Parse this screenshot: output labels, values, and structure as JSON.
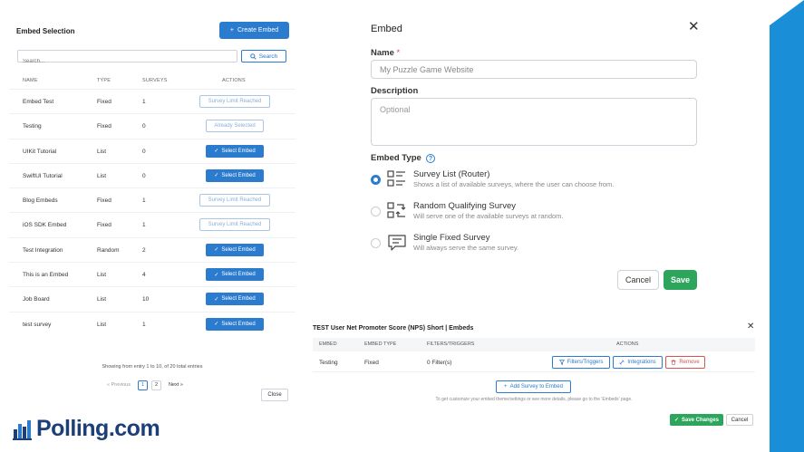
{
  "left_panel": {
    "title": "Embed Selection",
    "create_label": "Create Embed",
    "search_placeholder": "Search...",
    "search_label": "Search",
    "columns": [
      "NAME",
      "TYPE",
      "SURVEYS",
      "ACTIONS"
    ],
    "rows": [
      {
        "name": "Embed Test",
        "type": "Fixed",
        "surveys": "1",
        "action": "Survey Limit Reached",
        "action_kind": "disabled"
      },
      {
        "name": "Testing",
        "type": "Fixed",
        "surveys": "0",
        "action": "Already Selected",
        "action_kind": "disabled"
      },
      {
        "name": "UIKit Tutorial",
        "type": "List",
        "surveys": "0",
        "action": "Select Embed",
        "action_kind": "select"
      },
      {
        "name": "SwiftUI Tutorial",
        "type": "List",
        "surveys": "0",
        "action": "Select Embed",
        "action_kind": "select"
      },
      {
        "name": "Blog Embeds",
        "type": "Fixed",
        "surveys": "1",
        "action": "Survey Limit Reached",
        "action_kind": "disabled"
      },
      {
        "name": "iOS SDK Embed",
        "type": "Fixed",
        "surveys": "1",
        "action": "Survey Limit Reached",
        "action_kind": "disabled"
      },
      {
        "name": "Test Integration",
        "type": "Random",
        "surveys": "2",
        "action": "Select Embed",
        "action_kind": "select"
      },
      {
        "name": "This is an Embed",
        "type": "List",
        "surveys": "4",
        "action": "Select Embed",
        "action_kind": "select"
      },
      {
        "name": "Job Board",
        "type": "List",
        "surveys": "10",
        "action": "Select Embed",
        "action_kind": "select"
      },
      {
        "name": "test survey",
        "type": "List",
        "surveys": "1",
        "action": "Select Embed",
        "action_kind": "select"
      }
    ],
    "entries_text": "Showing from entry 1 to 10, of 20 total entries",
    "pager": {
      "prev": "« Previous",
      "pages": [
        "1",
        "2"
      ],
      "next": "Next »"
    },
    "close_label": "Close"
  },
  "logo": {
    "text": "Polling.com"
  },
  "embed_modal": {
    "title": "Embed",
    "name_label": "Name",
    "required_mark": "*",
    "name_placeholder": "My Puzzle Game Website",
    "description_label": "Description",
    "description_placeholder": "Optional",
    "embed_type_label": "Embed Type",
    "options": [
      {
        "title": "Survey List (Router)",
        "desc": "Shows a list of available surveys, where the user can choose from.",
        "checked": true,
        "icon": "list-icon"
      },
      {
        "title": "Random Qualifying Survey",
        "desc": "Will serve one of the available surveys at random.",
        "checked": false,
        "icon": "shuffle-icon"
      },
      {
        "title": "Single Fixed Survey",
        "desc": "Will always serve the same survey.",
        "checked": false,
        "icon": "message-icon"
      }
    ],
    "cancel_label": "Cancel",
    "save_label": "Save"
  },
  "nps_panel": {
    "title": "TEST User Net Promoter Score (NPS) Short | Embeds",
    "columns": [
      "EMBED",
      "EMBED TYPE",
      "FILTERS/TRIGGERS",
      "ACTIONS"
    ],
    "row": {
      "embed": "Testing",
      "type": "Fixed",
      "filters": "0 Filter(s)"
    },
    "filters_label": "Filters/Triggers",
    "integrations_label": "Integrations",
    "remove_label": "Remove",
    "add_label": "Add Survey to Embed",
    "hint": "To get customize your embed theme/settings or see more details, please go to the 'Embeds' page.",
    "save_changes_label": "Save Changes",
    "cancel_label": "Cancel"
  },
  "colors": {
    "accent": "#2b7bce",
    "success": "#2ea55d",
    "danger": "#d9534f",
    "deco": "#1a8fd8"
  }
}
